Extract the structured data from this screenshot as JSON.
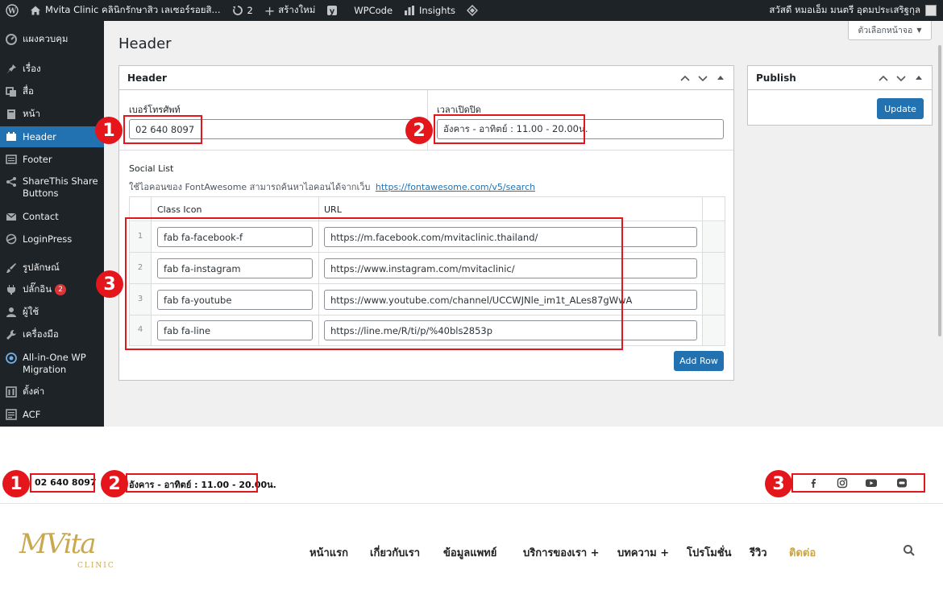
{
  "adminbar": {
    "site_name": "Mvita Clinic คลินิกรักษาสิว เลเซอร์รอยสิ...",
    "updates_count": "2",
    "new_label": "สร้างใหม่",
    "wpcode_label": "WPCode",
    "insights_label": "Insights",
    "greeting": "สวัสดี หมอเอ็ม มนตรี อุดมประเสริฐกุล"
  },
  "sidebar": {
    "items": [
      {
        "label": "แผงควบคุม",
        "icon": "dashboard-icon"
      },
      {
        "label": "เรื่อง",
        "icon": "pin-icon"
      },
      {
        "label": "สื่อ",
        "icon": "media-icon"
      },
      {
        "label": "หน้า",
        "icon": "page-icon"
      },
      {
        "label": "Header",
        "icon": "header-icon"
      },
      {
        "label": "Footer",
        "icon": "footer-icon"
      },
      {
        "label": "ShareThis Share Buttons",
        "label_line1": "ShareThis Share",
        "label_line2": "Buttons",
        "icon": "share-icon"
      },
      {
        "label": "Contact",
        "icon": "mail-icon"
      },
      {
        "label": "LoginPress",
        "icon": "loginpress-icon"
      },
      {
        "label": "รูปลักษณ์",
        "icon": "brush-icon"
      },
      {
        "label": "ปลั๊กอิน",
        "icon": "plugin-icon",
        "badge": "2"
      },
      {
        "label": "ผู้ใช้",
        "icon": "user-icon"
      },
      {
        "label": "เครื่องมือ",
        "icon": "wrench-icon"
      },
      {
        "label": "All-in-One WP Migration",
        "label_line1": "All-in-One WP",
        "label_line2": "Migration",
        "icon": "migration-icon"
      },
      {
        "label": "ตั้งค่า",
        "icon": "settings-icon"
      },
      {
        "label": "ACF",
        "icon": "acf-icon"
      }
    ],
    "active": "Header"
  },
  "screen_options": "ตัวเลือกหน้าจอ",
  "page_title": "Header",
  "header_box": {
    "title": "Header",
    "phone_label": "เบอร์โทรศัพท์",
    "phone_value": "02 640 8097",
    "hours_label": "เวลาเปิดปิด",
    "hours_value": "อังคาร - อาทิตย์ : 11.00 - 20.00น.",
    "social_label": "Social List",
    "social_help": "ใช้ไอคอนของ FontAwesome สามารถค้นหาไอคอนได้จากเว็บ",
    "social_help_link": "https://fontawesome.com/v5/search",
    "col_class_icon": "Class Icon",
    "col_url": "URL",
    "rows": [
      {
        "num": "1",
        "icon": "fab fa-facebook-f",
        "url": "https://m.facebook.com/mvitaclinic.thailand/"
      },
      {
        "num": "2",
        "icon": "fab fa-instagram",
        "url": "https://www.instagram.com/mvitaclinic/"
      },
      {
        "num": "3",
        "icon": "fab fa-youtube",
        "url": "https://www.youtube.com/channel/UCCWJNle_im1t_ALes87gWwA"
      },
      {
        "num": "4",
        "icon": "fab fa-line",
        "url": "https://line.me/R/ti/p/%40bls2853p"
      }
    ],
    "add_row_label": "Add Row"
  },
  "publish_box": {
    "title": "Publish",
    "update_label": "Update"
  },
  "annotations": [
    "1",
    "2",
    "3"
  ],
  "front": {
    "phone": "02 640 8097",
    "hours": "อังคาร - อาทิตย์ : 11.00 - 20.00น.",
    "logo_text": "MVita",
    "logo_sub": "CLINIC",
    "nav": [
      {
        "label": "หน้าแรก"
      },
      {
        "label": "เกี่ยวกับเรา"
      },
      {
        "label": "ข้อมูลแพทย์"
      },
      {
        "label": "บริการของเรา +"
      },
      {
        "label": "บทความ +"
      },
      {
        "label": "โปรโมชั่น"
      },
      {
        "label": "รีวิว"
      },
      {
        "label": "ติดต่อ"
      }
    ],
    "nav_active_color": "#c7a54b"
  }
}
